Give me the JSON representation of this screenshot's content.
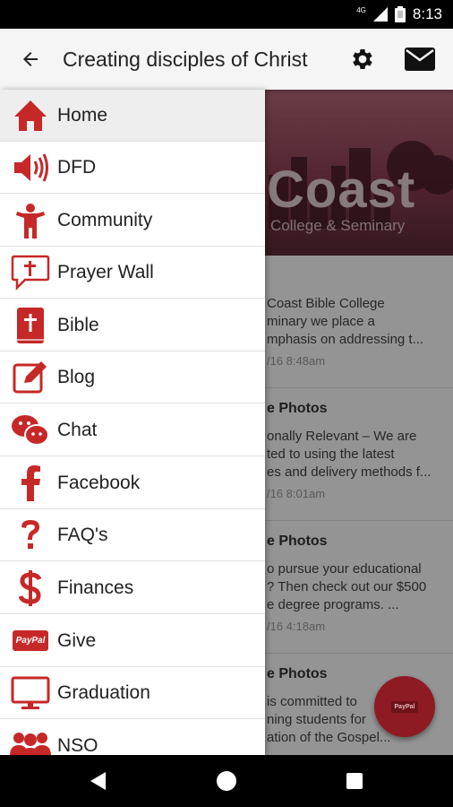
{
  "status_bar": {
    "time": "8:13",
    "network": "4G",
    "icons": [
      "signal-icon",
      "battery-icon"
    ]
  },
  "app_bar": {
    "title": "Creating disciples of Christ",
    "icons": [
      "back-arrow-icon",
      "gear-icon",
      "mail-icon"
    ]
  },
  "background": {
    "banner": {
      "brand": "Coast",
      "subtitle": "College & Seminary"
    },
    "cards": [
      {
        "title": "",
        "lines": [
          "Coast Bible College",
          "minary we place a",
          "mphasis on addressing t..."
        ],
        "date": "/16 8:48am"
      },
      {
        "title": "e Photos",
        "lines": [
          "onally Relevant – We are",
          "ted to using the latest",
          "es and delivery methods f..."
        ],
        "date": "/16 8:01am"
      },
      {
        "title": "e Photos",
        "lines": [
          "o pursue your educational",
          "? Then check out our $500",
          "e degree programs. ..."
        ],
        "date": "/16 4:18am"
      },
      {
        "title": "e Photos",
        "lines": [
          "is committed to",
          "ning students for",
          "ation of the Gospel..."
        ],
        "date": ""
      }
    ]
  },
  "fab": {
    "label": "PayPal"
  },
  "drawer": {
    "items": [
      {
        "label": "Home",
        "icon": "home-icon",
        "active": true
      },
      {
        "label": "DFD",
        "icon": "speaker-icon",
        "active": false
      },
      {
        "label": "Community",
        "icon": "person-icon",
        "active": false
      },
      {
        "label": "Prayer Wall",
        "icon": "prayer-bubble-icon",
        "active": false
      },
      {
        "label": "Bible",
        "icon": "bible-icon",
        "active": false
      },
      {
        "label": "Blog",
        "icon": "edit-icon",
        "active": false
      },
      {
        "label": "Chat",
        "icon": "chat-icon",
        "active": false
      },
      {
        "label": "Facebook",
        "icon": "facebook-icon",
        "active": false
      },
      {
        "label": "FAQ's",
        "icon": "question-icon",
        "active": false
      },
      {
        "label": "Finances",
        "icon": "dollar-icon",
        "active": false
      },
      {
        "label": "Give",
        "icon": "paypal-icon",
        "active": false,
        "badge": "PayPal"
      },
      {
        "label": "Graduation",
        "icon": "monitor-icon",
        "active": false
      },
      {
        "label": "NSO",
        "icon": "group-icon",
        "active": false
      }
    ]
  },
  "nav_bar": {
    "icons": [
      "back-triangle-icon",
      "home-circle-icon",
      "recents-square-icon"
    ]
  },
  "colors": {
    "accent": "#c62828",
    "drawer_active": "#eeeeee",
    "app_bar": "#f5f5f5"
  }
}
